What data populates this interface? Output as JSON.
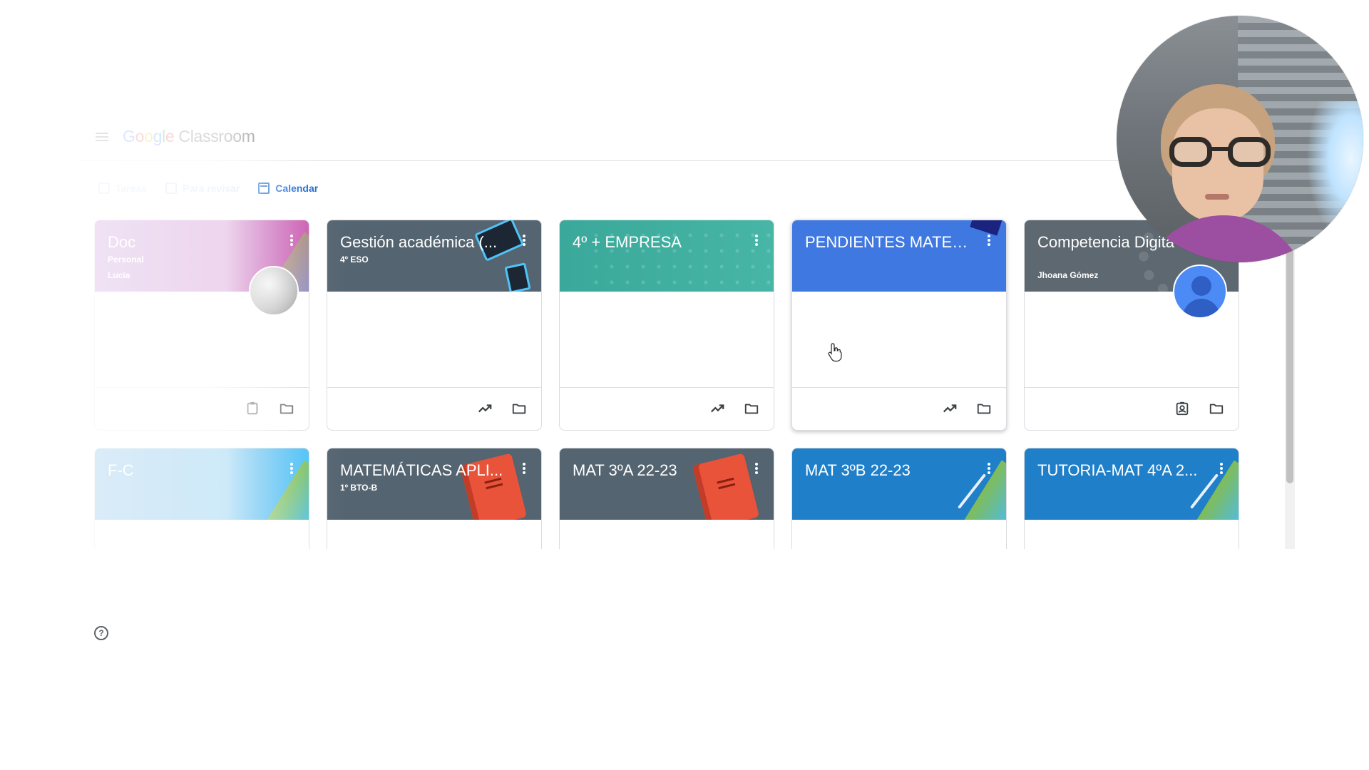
{
  "app": {
    "logo_letters": [
      "G",
      "o",
      "o",
      "g",
      "l",
      "e"
    ],
    "product_name": "Classroom"
  },
  "quicklinks": [
    {
      "label": "Tareas",
      "faded": true
    },
    {
      "label": "Para revisar",
      "faded": true
    },
    {
      "label": "Calendar",
      "faded": false
    }
  ],
  "cards": [
    {
      "title": "Doc",
      "subtitle": "Personal",
      "owner": "Lucía",
      "color": "#a04fbf",
      "color2": "#cd5fb2",
      "footer_icons": [
        "assignment-icon",
        "folder-icon"
      ],
      "faded": true
    },
    {
      "title": "Gestión académica (...",
      "subtitle": "4º ESO",
      "owner": "",
      "color": "#546470",
      "color2": "#546470",
      "footer_icons": [
        "trending-icon",
        "folder-icon"
      ],
      "faded": false
    },
    {
      "title": "4º + EMPRESA",
      "subtitle": "",
      "owner": "",
      "color": "#3aa89a",
      "color2": "#48b6a6",
      "footer_icons": [
        "trending-icon",
        "folder-icon"
      ],
      "faded": false
    },
    {
      "title": "PENDIENTES MATEM...",
      "subtitle": "",
      "owner": "",
      "color": "#3f78e0",
      "color2": "#3f78e0",
      "footer_icons": [
        "trending-icon",
        "folder-icon"
      ],
      "faded": false
    },
    {
      "title": "Competencia Digita",
      "subtitle": "",
      "owner": "Jhoana Gómez",
      "color": "#5e6870",
      "color2": "#5e6870",
      "footer_icons": [
        "assignment-ind-icon",
        "folder-icon"
      ],
      "faded": false
    },
    {
      "title": "F-C",
      "subtitle": "",
      "owner": "",
      "color": "#1e88d2",
      "color2": "#4fc3f7",
      "footer_icons": [
        "trending-icon",
        "folder-icon"
      ],
      "faded": true
    },
    {
      "title": "MATEMÁTICAS APLI...",
      "subtitle": "1º BTO-B",
      "owner": "",
      "color": "#546470",
      "color2": "#546470",
      "footer_icons": [
        "trending-icon",
        "folder-icon"
      ],
      "faded": false
    },
    {
      "title": "MAT 3ºA 22-23",
      "subtitle": "",
      "owner": "",
      "color": "#546470",
      "color2": "#546470",
      "footer_icons": [
        "trending-icon",
        "folder-icon"
      ],
      "faded": false
    },
    {
      "title": "MAT 3ºB 22-23",
      "subtitle": "",
      "owner": "",
      "color": "#1f7fc8",
      "color2": "#1f7fc8",
      "footer_icons": [
        "trending-icon",
        "folder-icon"
      ],
      "faded": false
    },
    {
      "title": "TUTORIA-MAT 4ºA 2...",
      "subtitle": "",
      "owner": "",
      "color": "#1f7fc8",
      "color2": "#1f7fc8",
      "footer_icons": [
        "trending-icon",
        "folder-icon"
      ],
      "faded": false
    }
  ],
  "colors": {
    "accent": "#1967d2",
    "divider": "#e0e0e0",
    "icon": "#5f6368"
  }
}
